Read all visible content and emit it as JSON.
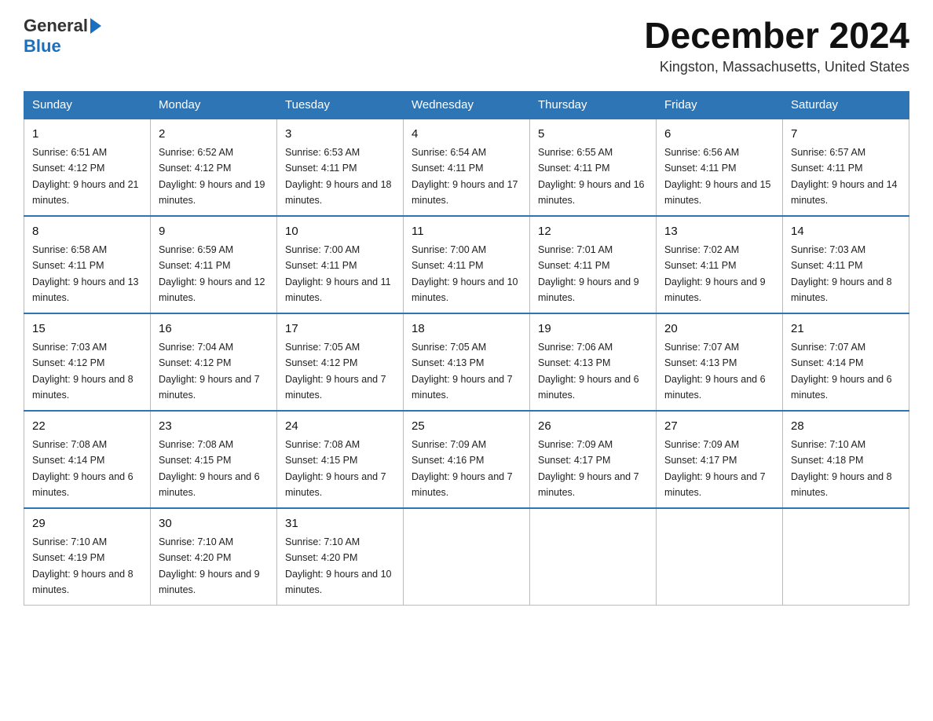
{
  "header": {
    "logo_general": "General",
    "logo_blue": "Blue",
    "month_title": "December 2024",
    "location": "Kingston, Massachusetts, United States"
  },
  "days_of_week": [
    "Sunday",
    "Monday",
    "Tuesday",
    "Wednesday",
    "Thursday",
    "Friday",
    "Saturday"
  ],
  "weeks": [
    [
      {
        "day": "1",
        "sunrise": "6:51 AM",
        "sunset": "4:12 PM",
        "daylight": "9 hours and 21 minutes."
      },
      {
        "day": "2",
        "sunrise": "6:52 AM",
        "sunset": "4:12 PM",
        "daylight": "9 hours and 19 minutes."
      },
      {
        "day": "3",
        "sunrise": "6:53 AM",
        "sunset": "4:11 PM",
        "daylight": "9 hours and 18 minutes."
      },
      {
        "day": "4",
        "sunrise": "6:54 AM",
        "sunset": "4:11 PM",
        "daylight": "9 hours and 17 minutes."
      },
      {
        "day": "5",
        "sunrise": "6:55 AM",
        "sunset": "4:11 PM",
        "daylight": "9 hours and 16 minutes."
      },
      {
        "day": "6",
        "sunrise": "6:56 AM",
        "sunset": "4:11 PM",
        "daylight": "9 hours and 15 minutes."
      },
      {
        "day": "7",
        "sunrise": "6:57 AM",
        "sunset": "4:11 PM",
        "daylight": "9 hours and 14 minutes."
      }
    ],
    [
      {
        "day": "8",
        "sunrise": "6:58 AM",
        "sunset": "4:11 PM",
        "daylight": "9 hours and 13 minutes."
      },
      {
        "day": "9",
        "sunrise": "6:59 AM",
        "sunset": "4:11 PM",
        "daylight": "9 hours and 12 minutes."
      },
      {
        "day": "10",
        "sunrise": "7:00 AM",
        "sunset": "4:11 PM",
        "daylight": "9 hours and 11 minutes."
      },
      {
        "day": "11",
        "sunrise": "7:00 AM",
        "sunset": "4:11 PM",
        "daylight": "9 hours and 10 minutes."
      },
      {
        "day": "12",
        "sunrise": "7:01 AM",
        "sunset": "4:11 PM",
        "daylight": "9 hours and 9 minutes."
      },
      {
        "day": "13",
        "sunrise": "7:02 AM",
        "sunset": "4:11 PM",
        "daylight": "9 hours and 9 minutes."
      },
      {
        "day": "14",
        "sunrise": "7:03 AM",
        "sunset": "4:11 PM",
        "daylight": "9 hours and 8 minutes."
      }
    ],
    [
      {
        "day": "15",
        "sunrise": "7:03 AM",
        "sunset": "4:12 PM",
        "daylight": "9 hours and 8 minutes."
      },
      {
        "day": "16",
        "sunrise": "7:04 AM",
        "sunset": "4:12 PM",
        "daylight": "9 hours and 7 minutes."
      },
      {
        "day": "17",
        "sunrise": "7:05 AM",
        "sunset": "4:12 PM",
        "daylight": "9 hours and 7 minutes."
      },
      {
        "day": "18",
        "sunrise": "7:05 AM",
        "sunset": "4:13 PM",
        "daylight": "9 hours and 7 minutes."
      },
      {
        "day": "19",
        "sunrise": "7:06 AM",
        "sunset": "4:13 PM",
        "daylight": "9 hours and 6 minutes."
      },
      {
        "day": "20",
        "sunrise": "7:07 AM",
        "sunset": "4:13 PM",
        "daylight": "9 hours and 6 minutes."
      },
      {
        "day": "21",
        "sunrise": "7:07 AM",
        "sunset": "4:14 PM",
        "daylight": "9 hours and 6 minutes."
      }
    ],
    [
      {
        "day": "22",
        "sunrise": "7:08 AM",
        "sunset": "4:14 PM",
        "daylight": "9 hours and 6 minutes."
      },
      {
        "day": "23",
        "sunrise": "7:08 AM",
        "sunset": "4:15 PM",
        "daylight": "9 hours and 6 minutes."
      },
      {
        "day": "24",
        "sunrise": "7:08 AM",
        "sunset": "4:15 PM",
        "daylight": "9 hours and 7 minutes."
      },
      {
        "day": "25",
        "sunrise": "7:09 AM",
        "sunset": "4:16 PM",
        "daylight": "9 hours and 7 minutes."
      },
      {
        "day": "26",
        "sunrise": "7:09 AM",
        "sunset": "4:17 PM",
        "daylight": "9 hours and 7 minutes."
      },
      {
        "day": "27",
        "sunrise": "7:09 AM",
        "sunset": "4:17 PM",
        "daylight": "9 hours and 7 minutes."
      },
      {
        "day": "28",
        "sunrise": "7:10 AM",
        "sunset": "4:18 PM",
        "daylight": "9 hours and 8 minutes."
      }
    ],
    [
      {
        "day": "29",
        "sunrise": "7:10 AM",
        "sunset": "4:19 PM",
        "daylight": "9 hours and 8 minutes."
      },
      {
        "day": "30",
        "sunrise": "7:10 AM",
        "sunset": "4:20 PM",
        "daylight": "9 hours and 9 minutes."
      },
      {
        "day": "31",
        "sunrise": "7:10 AM",
        "sunset": "4:20 PM",
        "daylight": "9 hours and 10 minutes."
      },
      null,
      null,
      null,
      null
    ]
  ]
}
